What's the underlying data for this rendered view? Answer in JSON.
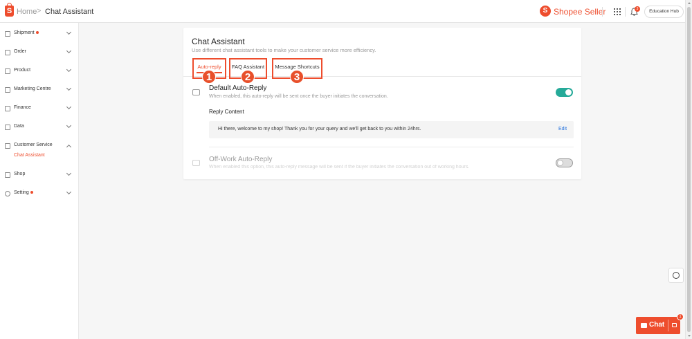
{
  "header": {
    "brand_glyph": "S",
    "breadcrumb_home": "Home",
    "breadcrumb_sep": ">",
    "breadcrumb_current": "Chat Assistant",
    "seller_logo_glyph": "S",
    "seller_text": "Shopee Seller",
    "notification_count": "3",
    "education_hub": "Education Hub"
  },
  "sidebar": {
    "items": [
      {
        "label": "Shipment",
        "icon": "truck-icon",
        "dot": true
      },
      {
        "label": "Order",
        "icon": "clipboard-icon",
        "dot": false
      },
      {
        "label": "Product",
        "icon": "box-icon",
        "dot": false
      },
      {
        "label": "Marketing Centre",
        "icon": "tag-icon",
        "dot": false
      },
      {
        "label": "Finance",
        "icon": "wallet-icon",
        "dot": false
      },
      {
        "label": "Data",
        "icon": "chart-icon",
        "dot": false
      },
      {
        "label": "Customer Service",
        "icon": "headset-icon",
        "dot": false,
        "expanded": true
      },
      {
        "label": "Shop",
        "icon": "shop-icon",
        "dot": false
      },
      {
        "label": "Setting",
        "icon": "gear-icon",
        "dot": true
      }
    ],
    "sub_item": "Chat Assistant"
  },
  "main": {
    "title": "Chat Assistant",
    "subtitle": "Use different chat assistant tools to make your customer service more efficiency.",
    "tabs": [
      {
        "label": "Auto-reply",
        "number": "1"
      },
      {
        "label": "FAQ Assistant",
        "number": "2"
      },
      {
        "label": "Message Shortcuts",
        "number": "3"
      }
    ],
    "default_reply": {
      "title": "Default Auto-Reply",
      "desc": "When enabled, this auto-reply will be sent once the buyer initiates the conversation.",
      "enabled": true,
      "content_label": "Reply Content",
      "content_text": "Hi there, welcome to my shop! Thank you for your query and we'll get back to you within 24hrs.",
      "edit_label": "Edit"
    },
    "offwork_reply": {
      "title": "Off-Work Auto-Reply",
      "desc": "When enabled this option, this auto-reply message will be sent if the buyer initiates the conversation out of working hours.",
      "enabled": false
    }
  },
  "chat_widget": {
    "label": "Chat",
    "badge": "1"
  },
  "colors": {
    "accent": "#ee4d2d",
    "toggle_on": "#26aa99",
    "link": "#2673dd"
  }
}
